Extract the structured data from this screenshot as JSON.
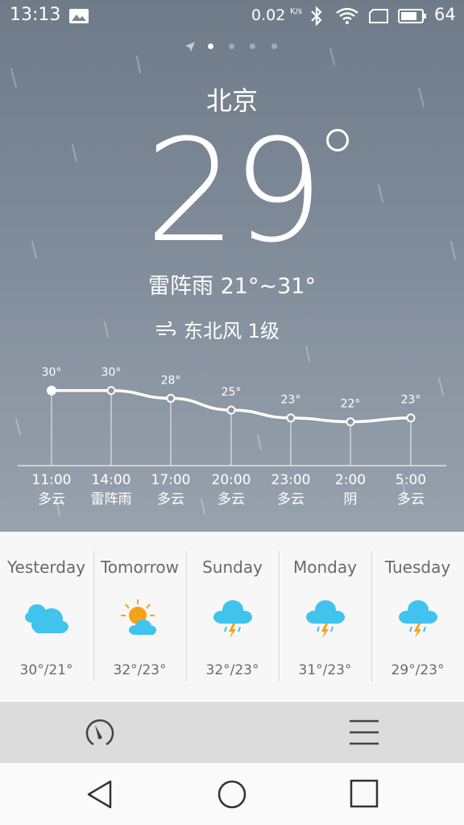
{
  "status_bar": {
    "time": "13:13",
    "net_speed": "0.02",
    "net_unit": "K/s",
    "battery": "64",
    "icons": [
      "image-icon",
      "bluetooth-icon",
      "wifi-icon",
      "sim-icon",
      "battery-icon"
    ]
  },
  "location": {
    "city": "北京"
  },
  "current": {
    "temperature": "29",
    "condition": "雷阵雨 21°~31°",
    "wind": "东北风 1级"
  },
  "hourly": {
    "temps": [
      "30°",
      "30°",
      "28°",
      "25°",
      "23°",
      "22°",
      "23°"
    ],
    "times": [
      "11:00",
      "14:00",
      "17:00",
      "20:00",
      "23:00",
      "2:00",
      "5:00"
    ],
    "conditions": [
      "多云",
      "雷阵雨",
      "多云",
      "多云",
      "多云",
      "阴",
      "多云"
    ]
  },
  "chart_data": {
    "type": "line",
    "categories": [
      "11:00",
      "14:00",
      "17:00",
      "20:00",
      "23:00",
      "2:00",
      "5:00"
    ],
    "values": [
      30,
      30,
      28,
      25,
      23,
      22,
      23
    ],
    "ylim": [
      18,
      32
    ]
  },
  "daily": [
    {
      "name": "Yesterday",
      "range": "30°/21°",
      "icon": "cloudy-icon"
    },
    {
      "name": "Tomorrow",
      "range": "32°/23°",
      "icon": "partly-sunny-icon"
    },
    {
      "name": "Sunday",
      "range": "32°/23°",
      "icon": "thunderstorm-icon"
    },
    {
      "name": "Monday",
      "range": "31°/23°",
      "icon": "thunderstorm-icon"
    },
    {
      "name": "Tuesday",
      "range": "29°/23°",
      "icon": "thunderstorm-icon"
    }
  ],
  "colors": {
    "cloud": "#40c4ee",
    "sun": "#f5a21b",
    "lightning": "#f5a21b"
  }
}
